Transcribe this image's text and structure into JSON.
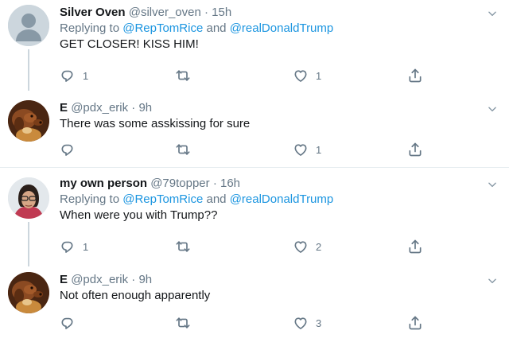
{
  "tweets": [
    {
      "name": "Silver Oven",
      "handle": "@silver_oven",
      "separator": "·",
      "time": "15h",
      "replying_prefix": "Replying to",
      "mention_1": "@RepTomRice",
      "replying_and": "and",
      "mention_2": "@realDonaldTrump",
      "text": "GET CLOSER! KISS HIM!",
      "reply_count": "1",
      "retweet_count": "",
      "like_count": "1",
      "avatar": "default-silhouette"
    },
    {
      "name": "E",
      "handle": "@pdx_erik",
      "separator": "·",
      "time": "9h",
      "text": "There was some asskissing for sure",
      "reply_count": "",
      "retweet_count": "",
      "like_count": "1",
      "avatar": "dog-painting"
    },
    {
      "name": "my own person",
      "handle": "@79topper",
      "separator": "·",
      "time": "16h",
      "replying_prefix": "Replying to",
      "mention_1": "@RepTomRice",
      "replying_and": "and",
      "mention_2": "@realDonaldTrump",
      "text": "When were you with Trump??",
      "reply_count": "1",
      "retweet_count": "",
      "like_count": "2",
      "avatar": "person-photo"
    },
    {
      "name": "E",
      "handle": "@pdx_erik",
      "separator": "·",
      "time": "9h",
      "text": "Not often enough apparently",
      "reply_count": "",
      "retweet_count": "",
      "like_count": "3",
      "avatar": "dog-painting"
    }
  ],
  "colors": {
    "link": "#1b95e0",
    "secondary": "#657786",
    "thread_line": "#ccd6dd",
    "divider": "#e6ecf0"
  },
  "icons": [
    "reply-icon",
    "retweet-icon",
    "like-icon",
    "share-icon",
    "chevron-down-icon"
  ]
}
